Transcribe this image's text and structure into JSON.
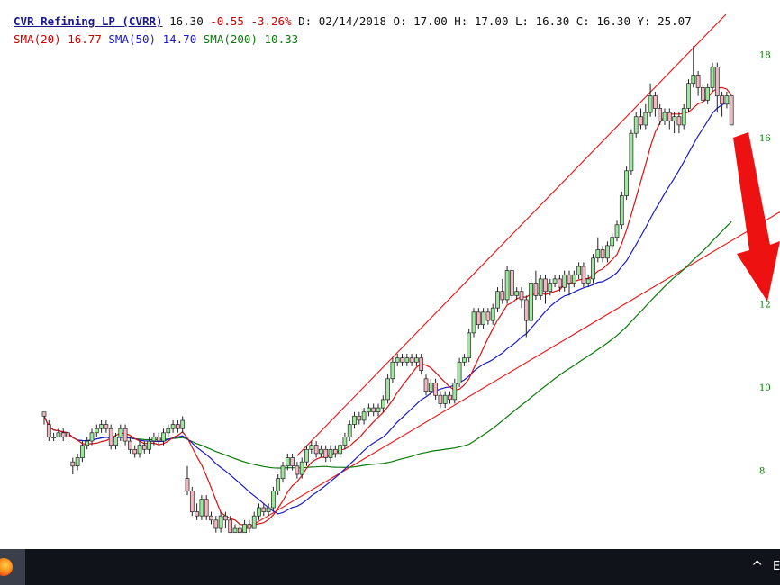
{
  "header": {
    "name": "CVR Refining LP (CVRR)",
    "last": "16.30",
    "change": "-0.55",
    "pct_change": "-3.26%",
    "date_text": "D: 02/14/2018",
    "open_text": "O: 17.00",
    "high_text": "H: 17.00",
    "low_text": "L: 16.30",
    "close_text": "C: 16.30",
    "y_text": "Y: 25.07",
    "sma20_label": "SMA(20)",
    "sma20_value": "16.77",
    "sma50_label": "SMA(50)",
    "sma50_value": "14.70",
    "sma200_label": "SMA(200)",
    "sma200_value": "10.33"
  },
  "colors": {
    "up_candle": "#9ee89e",
    "down_candle": "#f0b8c0",
    "candle_outline": "#222222",
    "sma20": "#dd1111",
    "sma50": "#1a1acc",
    "sma200": "#0a7a0a",
    "trendline": "#ee1111",
    "arrow": "#ee1111",
    "axis_label": "#0a7a0a",
    "taskbar": "#10131a"
  },
  "taskbar": {
    "app_icon": "firefox-icon",
    "chevron": "^",
    "lang": "E"
  },
  "chart_data": {
    "type": "candlestick",
    "title": "CVR Refining LP (CVRR)",
    "ylim": [
      6.5,
      19
    ],
    "y_ticks": [
      8,
      10,
      12,
      16,
      18
    ],
    "grid": false,
    "candles": [
      [
        9.4,
        9.3,
        9.4,
        9.1
      ],
      [
        9.1,
        8.8,
        9.2,
        8.7
      ],
      [
        8.8,
        8.8,
        8.9,
        8.7
      ],
      [
        8.8,
        8.9,
        9.0,
        8.8
      ],
      [
        8.9,
        8.8,
        9.0,
        8.7
      ],
      [
        8.9,
        8.8,
        8.9,
        8.7
      ],
      [
        8.2,
        8.1,
        8.3,
        7.9
      ],
      [
        8.1,
        8.3,
        8.4,
        8.0
      ],
      [
        8.3,
        8.6,
        8.7,
        8.2
      ],
      [
        8.6,
        8.7,
        8.8,
        8.5
      ],
      [
        8.7,
        8.9,
        9.0,
        8.6
      ],
      [
        8.9,
        9.0,
        9.1,
        8.8
      ],
      [
        9.0,
        9.1,
        9.2,
        8.9
      ],
      [
        9.1,
        9.0,
        9.2,
        8.9
      ],
      [
        9.0,
        8.6,
        9.1,
        8.5
      ],
      [
        8.6,
        8.8,
        8.9,
        8.5
      ],
      [
        8.8,
        9.0,
        9.1,
        8.7
      ],
      [
        9.0,
        8.7,
        9.1,
        8.6
      ],
      [
        8.7,
        8.5,
        8.8,
        8.4
      ],
      [
        8.5,
        8.4,
        8.6,
        8.3
      ],
      [
        8.4,
        8.6,
        8.7,
        8.3
      ],
      [
        8.6,
        8.5,
        8.7,
        8.4
      ],
      [
        8.5,
        8.7,
        8.8,
        8.4
      ],
      [
        8.7,
        8.8,
        8.9,
        8.6
      ],
      [
        8.8,
        8.7,
        8.9,
        8.6
      ],
      [
        8.7,
        8.9,
        9.0,
        8.6
      ],
      [
        8.9,
        9.0,
        9.1,
        8.8
      ],
      [
        9.0,
        9.1,
        9.2,
        8.9
      ],
      [
        9.1,
        9.0,
        9.2,
        8.9
      ],
      [
        9.0,
        9.2,
        9.3,
        8.9
      ],
      [
        7.8,
        7.5,
        8.1,
        7.4
      ],
      [
        7.5,
        7.0,
        7.6,
        6.9
      ],
      [
        7.0,
        6.9,
        7.2,
        6.8
      ],
      [
        6.9,
        7.3,
        7.4,
        6.8
      ],
      [
        7.3,
        6.9,
        7.4,
        6.8
      ],
      [
        6.9,
        6.8,
        7.0,
        6.7
      ],
      [
        6.8,
        6.6,
        6.9,
        6.5
      ],
      [
        6.6,
        6.9,
        7.0,
        6.5
      ],
      [
        6.9,
        6.8,
        7.0,
        6.6
      ],
      [
        6.8,
        6.5,
        6.9,
        6.5
      ],
      [
        6.5,
        6.6,
        6.7,
        6.5
      ],
      [
        6.6,
        6.5,
        6.7,
        6.5
      ],
      [
        6.5,
        6.7,
        6.8,
        6.5
      ],
      [
        6.7,
        6.6,
        6.8,
        6.5
      ],
      [
        6.6,
        6.9,
        7.0,
        6.6
      ],
      [
        6.9,
        7.1,
        7.2,
        6.8
      ],
      [
        7.1,
        7.0,
        7.2,
        6.9
      ],
      [
        7.0,
        7.1,
        7.2,
        6.9
      ],
      [
        7.1,
        7.5,
        7.6,
        7.0
      ],
      [
        7.5,
        7.8,
        7.9,
        7.4
      ],
      [
        7.8,
        8.1,
        8.2,
        7.7
      ],
      [
        8.1,
        8.3,
        8.4,
        8.0
      ],
      [
        8.3,
        8.1,
        8.4,
        8.0
      ],
      [
        8.1,
        7.9,
        8.2,
        7.8
      ],
      [
        7.9,
        8.2,
        8.3,
        7.8
      ],
      [
        8.2,
        8.5,
        8.6,
        8.1
      ],
      [
        8.5,
        8.6,
        8.7,
        8.4
      ],
      [
        8.6,
        8.4,
        8.7,
        8.3
      ],
      [
        8.4,
        8.5,
        8.6,
        8.3
      ],
      [
        8.5,
        8.3,
        8.6,
        8.2
      ],
      [
        8.3,
        8.5,
        8.6,
        8.2
      ],
      [
        8.5,
        8.4,
        8.6,
        8.3
      ],
      [
        8.4,
        8.6,
        8.7,
        8.3
      ],
      [
        8.6,
        8.8,
        8.9,
        8.5
      ],
      [
        8.8,
        9.1,
        9.2,
        8.7
      ],
      [
        9.1,
        9.3,
        9.4,
        9.0
      ],
      [
        9.3,
        9.2,
        9.4,
        9.1
      ],
      [
        9.2,
        9.4,
        9.5,
        9.1
      ],
      [
        9.4,
        9.5,
        9.6,
        9.3
      ],
      [
        9.5,
        9.4,
        9.6,
        9.3
      ],
      [
        9.4,
        9.5,
        9.6,
        9.3
      ],
      [
        9.5,
        9.7,
        9.8,
        9.4
      ],
      [
        9.7,
        10.2,
        10.3,
        9.6
      ],
      [
        10.2,
        10.6,
        10.7,
        10.1
      ],
      [
        10.6,
        10.7,
        10.8,
        10.5
      ],
      [
        10.7,
        10.6,
        10.8,
        10.5
      ],
      [
        10.6,
        10.7,
        10.8,
        10.5
      ],
      [
        10.7,
        10.6,
        10.8,
        10.5
      ],
      [
        10.6,
        10.7,
        10.8,
        10.5
      ],
      [
        10.7,
        10.4,
        10.8,
        10.3
      ],
      [
        10.2,
        9.9,
        10.3,
        9.8
      ],
      [
        9.9,
        10.1,
        10.2,
        9.8
      ],
      [
        10.1,
        9.8,
        10.2,
        9.7
      ],
      [
        9.8,
        9.6,
        9.9,
        9.5
      ],
      [
        9.6,
        9.8,
        9.9,
        9.5
      ],
      [
        9.8,
        9.7,
        9.9,
        9.6
      ],
      [
        9.7,
        10.1,
        10.2,
        9.6
      ],
      [
        10.1,
        10.6,
        10.7,
        10.0
      ],
      [
        10.6,
        10.7,
        10.8,
        10.5
      ],
      [
        10.7,
        11.3,
        11.4,
        10.6
      ],
      [
        11.3,
        11.8,
        11.9,
        11.2
      ],
      [
        11.8,
        11.5,
        11.9,
        11.4
      ],
      [
        11.5,
        11.8,
        11.9,
        11.4
      ],
      [
        11.8,
        11.6,
        11.9,
        11.5
      ],
      [
        11.6,
        11.9,
        12.0,
        11.5
      ],
      [
        11.9,
        12.3,
        12.4,
        11.8
      ],
      [
        12.3,
        12.1,
        12.6,
        12.0
      ],
      [
        12.1,
        12.8,
        12.9,
        12.0
      ],
      [
        12.8,
        12.2,
        12.9,
        12.1
      ],
      [
        12.2,
        12.3,
        12.4,
        12.1
      ],
      [
        12.3,
        12.1,
        12.4,
        11.9
      ],
      [
        12.1,
        11.6,
        12.2,
        11.2
      ],
      [
        11.6,
        12.5,
        12.6,
        11.5
      ],
      [
        12.5,
        12.2,
        12.8,
        12.1
      ],
      [
        12.2,
        12.6,
        12.7,
        12.1
      ],
      [
        12.6,
        12.3,
        12.7,
        12.0
      ],
      [
        12.3,
        12.5,
        12.6,
        12.2
      ],
      [
        12.5,
        12.6,
        12.7,
        12.4
      ],
      [
        12.6,
        12.4,
        12.7,
        12.3
      ],
      [
        12.4,
        12.7,
        12.8,
        12.3
      ],
      [
        12.7,
        12.5,
        12.8,
        12.2
      ],
      [
        12.5,
        12.7,
        12.8,
        12.4
      ],
      [
        12.7,
        12.9,
        13.0,
        12.6
      ],
      [
        12.9,
        12.5,
        13.0,
        12.4
      ],
      [
        12.5,
        12.6,
        12.7,
        12.4
      ],
      [
        12.6,
        13.1,
        13.2,
        12.5
      ],
      [
        13.1,
        13.3,
        13.6,
        13.0
      ],
      [
        13.3,
        13.1,
        13.4,
        13.0
      ],
      [
        13.1,
        13.4,
        13.5,
        13.0
      ],
      [
        13.4,
        13.6,
        13.7,
        13.3
      ],
      [
        13.6,
        13.9,
        14.0,
        13.5
      ],
      [
        13.9,
        14.6,
        14.7,
        13.8
      ],
      [
        14.6,
        15.2,
        15.3,
        14.5
      ],
      [
        15.2,
        16.1,
        16.2,
        15.1
      ],
      [
        16.1,
        16.5,
        16.6,
        16.0
      ],
      [
        16.5,
        16.3,
        16.7,
        16.2
      ],
      [
        16.3,
        16.6,
        16.8,
        16.2
      ],
      [
        16.6,
        17.0,
        17.3,
        16.5
      ],
      [
        17.0,
        16.7,
        17.1,
        16.5
      ],
      [
        16.7,
        16.4,
        16.8,
        16.3
      ],
      [
        16.4,
        16.6,
        16.7,
        16.3
      ],
      [
        16.6,
        16.4,
        16.7,
        16.2
      ],
      [
        16.4,
        16.5,
        16.6,
        16.1
      ],
      [
        16.5,
        16.3,
        16.6,
        16.1
      ],
      [
        16.3,
        16.7,
        16.8,
        16.2
      ],
      [
        16.7,
        17.3,
        17.4,
        16.6
      ],
      [
        17.3,
        17.5,
        18.2,
        17.2
      ],
      [
        17.5,
        17.2,
        17.6,
        17.0
      ],
      [
        17.2,
        16.9,
        17.3,
        16.8
      ],
      [
        16.9,
        17.2,
        17.3,
        16.8
      ],
      [
        17.2,
        17.7,
        17.8,
        17.1
      ],
      [
        17.7,
        17.0,
        17.8,
        16.6
      ],
      [
        17.0,
        16.8,
        17.1,
        16.5
      ],
      [
        16.8,
        17.0,
        17.1,
        16.7
      ],
      [
        17.0,
        16.3,
        17.0,
        16.3
      ]
    ]
  }
}
